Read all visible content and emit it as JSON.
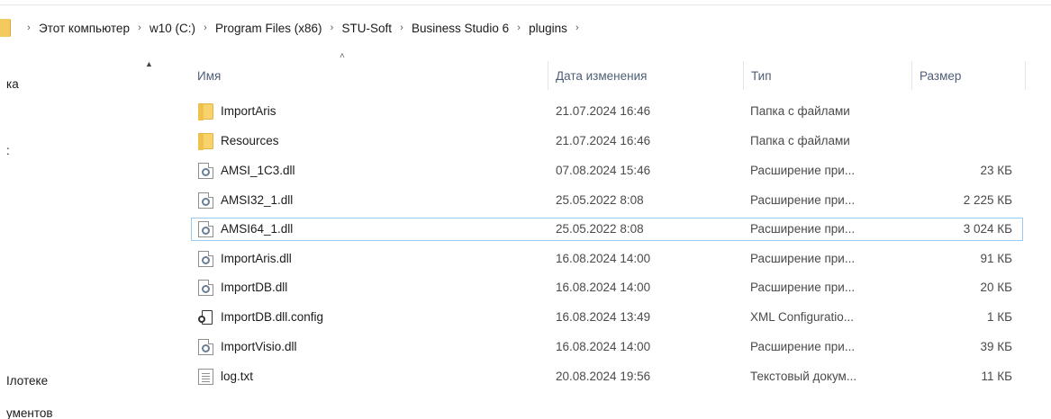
{
  "breadcrumb": [
    {
      "label": "Этот компьютер"
    },
    {
      "label": "w10 (C:)"
    },
    {
      "label": "Program Files (x86)"
    },
    {
      "label": "STU-Soft"
    },
    {
      "label": "Business Studio 6"
    },
    {
      "label": "plugins"
    }
  ],
  "nav": {
    "items": [
      {
        "label": "ка"
      },
      {
        "label": ":"
      },
      {
        "label": "Ілотеке"
      },
      {
        "label": "ументов"
      }
    ]
  },
  "columns": {
    "name": "Имя",
    "date": "Дата изменения",
    "type": "Тип",
    "size": "Размер"
  },
  "files": [
    {
      "name": "ImportAris",
      "date": "21.07.2024 16:46",
      "type": "Папка с файлами",
      "size": "",
      "icon": "folder-icon"
    },
    {
      "name": "Resources",
      "date": "21.07.2024 16:46",
      "type": "Папка с файлами",
      "size": "",
      "icon": "folder-icon"
    },
    {
      "name": "AMSI_1C3.dll",
      "date": "07.08.2024 15:46",
      "type": "Расширение при...",
      "size": "23 КБ",
      "icon": "dll-icon"
    },
    {
      "name": "AMSI32_1.dll",
      "date": "25.05.2022 8:08",
      "type": "Расширение при...",
      "size": "2 225 КБ",
      "icon": "dll-icon"
    },
    {
      "name": "AMSI64_1.dll",
      "date": "25.05.2022 8:08",
      "type": "Расширение при...",
      "size": "3 024 КБ",
      "icon": "dll-icon"
    },
    {
      "name": "ImportAris.dll",
      "date": "16.08.2024 14:00",
      "type": "Расширение при...",
      "size": "91 КБ",
      "icon": "dll-icon"
    },
    {
      "name": "ImportDB.dll",
      "date": "16.08.2024 14:00",
      "type": "Расширение при...",
      "size": "20 КБ",
      "icon": "dll-icon"
    },
    {
      "name": "ImportDB.dll.config",
      "date": "16.08.2024 13:49",
      "type": "XML Configuratio...",
      "size": "1 КБ",
      "icon": "config-file-icon"
    },
    {
      "name": "ImportVisio.dll",
      "date": "16.08.2024 14:00",
      "type": "Расширение при...",
      "size": "39 КБ",
      "icon": "dll-icon"
    },
    {
      "name": "log.txt",
      "date": "20.08.2024 19:56",
      "type": "Текстовый докум...",
      "size": "11 КБ",
      "icon": "text-file-icon"
    }
  ],
  "selected_index": 4,
  "colors": {
    "folder": "#f8d36b",
    "selection_border": "#99c9ef",
    "header_text": "#4d5e75"
  }
}
